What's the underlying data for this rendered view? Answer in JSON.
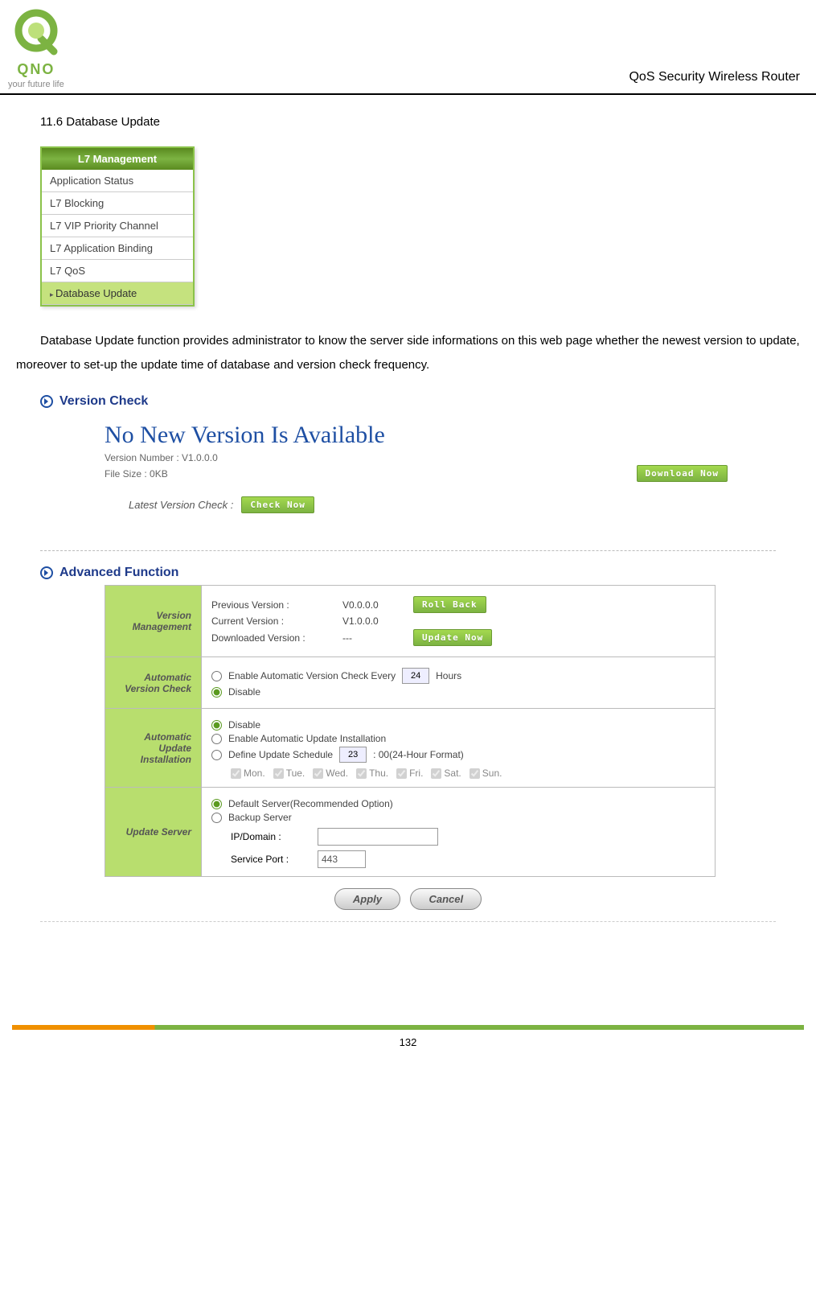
{
  "header": {
    "brand": "QNO",
    "tagline": "your future life",
    "right": "QoS Security Wireless Router"
  },
  "section_title": "11.6 Database Update",
  "nav": {
    "header": "L7 Management",
    "items": [
      "Application Status",
      "L7 Blocking",
      "L7 VIP Priority Channel",
      "L7 Application Binding",
      "L7 QoS",
      "Database Update"
    ],
    "active_index": 5
  },
  "paragraph": "Database Update function provides administrator to know the server side informations on this web page whether the newest version to update, moreover to set-up the update time of database and version check frequency.",
  "version_check": {
    "title": "Version Check",
    "message": "No New Version Is Available",
    "version_label": "Version Number : V1.0.0.0",
    "filesize_label": "File Size : 0KB",
    "download_btn": "Download Now",
    "check_label": "Latest Version Check :",
    "check_btn": "Check Now"
  },
  "advanced": {
    "title": "Advanced Function",
    "vm": {
      "heading": "Version Management",
      "previous_label": "Previous Version :",
      "previous_value": "V0.0.0.0",
      "rollback_btn": "Roll Back",
      "current_label": "Current Version :",
      "current_value": "V1.0.0.0",
      "downloaded_label": "Downloaded Version :",
      "downloaded_value": "---",
      "update_btn": "Update Now"
    },
    "avc": {
      "heading": "Automatic Version Check",
      "opt1_pre": "Enable Automatic Version Check Every",
      "opt1_value": "24",
      "opt1_post": "Hours",
      "opt2": "Disable"
    },
    "aui": {
      "heading": "Automatic Update Installation",
      "opt1": "Disable",
      "opt2": "Enable Automatic Update Installation",
      "opt3_pre": "Define Update Schedule",
      "opt3_value": "23",
      "opt3_post": ": 00(24-Hour Format)",
      "days": [
        "Mon.",
        "Tue.",
        "Wed.",
        "Thu.",
        "Fri.",
        "Sat.",
        "Sun."
      ]
    },
    "us": {
      "heading": "Update Server",
      "opt1": "Default Server(Recommended Option)",
      "opt2": "Backup Server",
      "ip_label": "IP/Domain :",
      "port_label": "Service Port :",
      "port_value": "443"
    }
  },
  "buttons": {
    "apply": "Apply",
    "cancel": "Cancel"
  },
  "page_number": "132"
}
